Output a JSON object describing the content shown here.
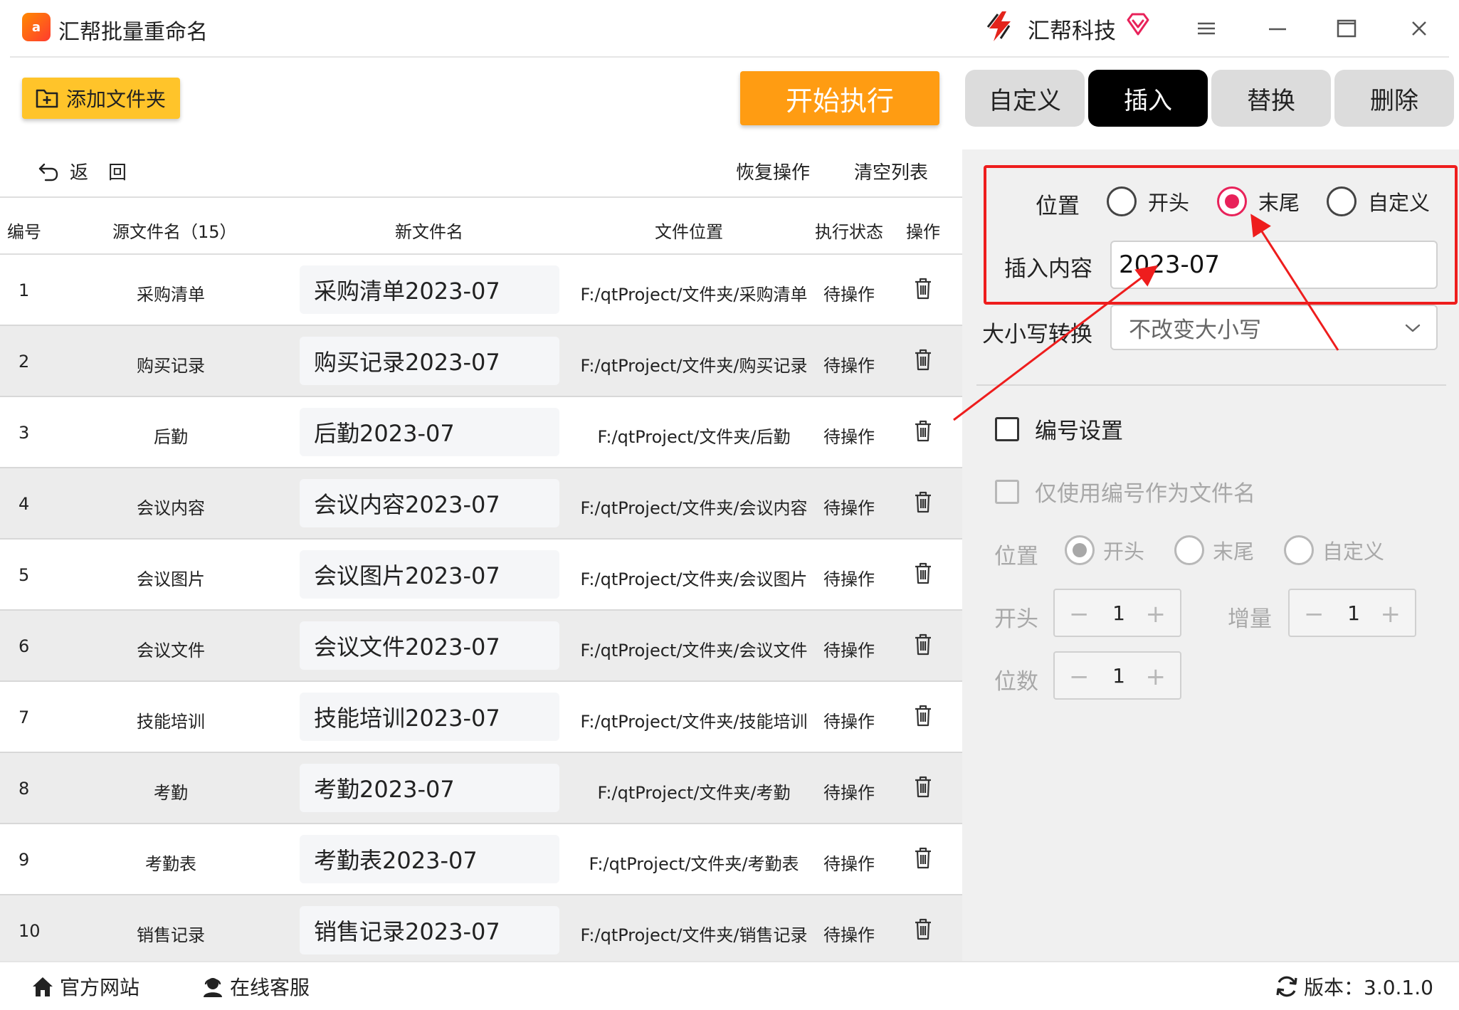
{
  "app": {
    "title": "汇帮批量重命名",
    "logo_text": "a",
    "brand_name": "汇帮科技"
  },
  "toolbar": {
    "add_folder_label": "添加文件夹",
    "start_label": "开始执行"
  },
  "tabs": [
    {
      "label": "自定义",
      "active": false
    },
    {
      "label": "插入",
      "active": true
    },
    {
      "label": "替换",
      "active": false
    },
    {
      "label": "删除",
      "active": false
    }
  ],
  "list_toolbar": {
    "back_label": "返回",
    "restore_label": "恢复操作",
    "clear_label": "清空列表"
  },
  "table": {
    "headers": {
      "num": "编号",
      "source": "源文件名（15）",
      "new_name": "新文件名",
      "location": "文件位置",
      "status": "执行状态",
      "op": "操作"
    },
    "rows": [
      {
        "num": "1",
        "source": "采购清单",
        "new_name": "采购清单2023-07",
        "location": "F:/qtProject/文件夹/采购清单",
        "status": "待操作"
      },
      {
        "num": "2",
        "source": "购买记录",
        "new_name": "购买记录2023-07",
        "location": "F:/qtProject/文件夹/购买记录",
        "status": "待操作"
      },
      {
        "num": "3",
        "source": "后勤",
        "new_name": "后勤2023-07",
        "location": "F:/qtProject/文件夹/后勤",
        "status": "待操作"
      },
      {
        "num": "4",
        "source": "会议内容",
        "new_name": "会议内容2023-07",
        "location": "F:/qtProject/文件夹/会议内容",
        "status": "待操作"
      },
      {
        "num": "5",
        "source": "会议图片",
        "new_name": "会议图片2023-07",
        "location": "F:/qtProject/文件夹/会议图片",
        "status": "待操作"
      },
      {
        "num": "6",
        "source": "会议文件",
        "new_name": "会议文件2023-07",
        "location": "F:/qtProject/文件夹/会议文件",
        "status": "待操作"
      },
      {
        "num": "7",
        "source": "技能培训",
        "new_name": "技能培训2023-07",
        "location": "F:/qtProject/文件夹/技能培训",
        "status": "待操作"
      },
      {
        "num": "8",
        "source": "考勤",
        "new_name": "考勤2023-07",
        "location": "F:/qtProject/文件夹/考勤",
        "status": "待操作"
      },
      {
        "num": "9",
        "source": "考勤表",
        "new_name": "考勤表2023-07",
        "location": "F:/qtProject/文件夹/考勤表",
        "status": "待操作"
      },
      {
        "num": "10",
        "source": "销售记录",
        "new_name": "销售记录2023-07",
        "location": "F:/qtProject/文件夹/销售记录",
        "status": "待操作"
      }
    ]
  },
  "insert_panel": {
    "position_label": "位置",
    "position_options": [
      "开头",
      "末尾",
      "自定义"
    ],
    "position_selected": "末尾",
    "content_label": "插入内容",
    "content_value": "2023-07",
    "case_label": "大小写转换",
    "case_value": "不改变大小写",
    "highlight_color": "#ee1d1d",
    "radio_color": "#e8225a"
  },
  "numbering": {
    "enable_label": "编号设置",
    "only_number_label": "仅使用编号作为文件名",
    "position_label": "位置",
    "position_options": [
      "开头",
      "末尾",
      "自定义"
    ],
    "position_selected": "开头",
    "start_label": "开头",
    "start_value": "1",
    "increment_label": "增量",
    "increment_value": "1",
    "digits_label": "位数",
    "digits_value": "1",
    "minus": "−",
    "plus": "+"
  },
  "footer": {
    "official_site": "官方网站",
    "support": "在线客服",
    "version": "版本：3.0.1.0"
  },
  "colors": {
    "accent_yellow": "#ffc42a",
    "accent_orange": "#ff9c12",
    "tab_active": "#000000",
    "tab_inactive": "#dcdcdc"
  }
}
